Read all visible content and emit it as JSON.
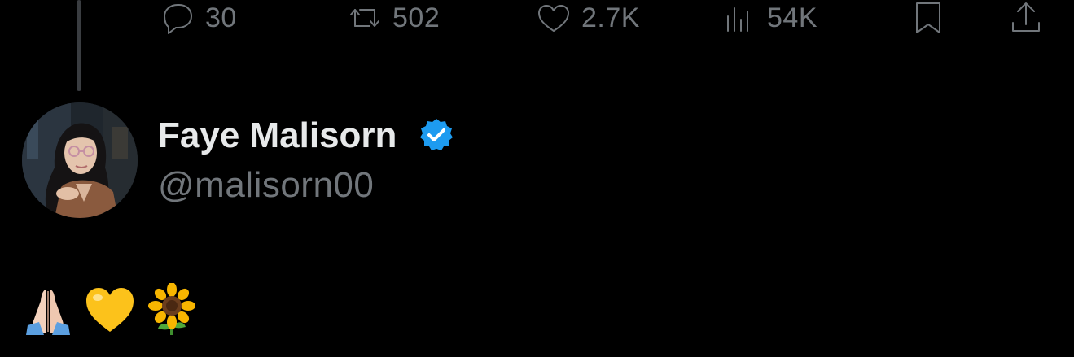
{
  "actions": {
    "reply": {
      "icon": "reply-icon",
      "count": "30"
    },
    "repost": {
      "icon": "repost-icon",
      "count": "502"
    },
    "like": {
      "icon": "heart-icon",
      "count": "2.7K"
    },
    "views": {
      "icon": "views-icon",
      "count": "54K"
    },
    "bookmark": {
      "icon": "bookmark-icon"
    },
    "share": {
      "icon": "share-icon"
    }
  },
  "author": {
    "display_name": "Faye Malisorn",
    "handle": "@malisorn00",
    "verified": true,
    "verified_color": "#1d9bf0"
  },
  "tweet": {
    "emojis": [
      "folded-hands",
      "yellow-heart",
      "sunflower"
    ]
  },
  "colors": {
    "background": "#000000",
    "primary_text": "#e7e9ea",
    "secondary_text": "#71767b",
    "divider": "#2f3336"
  }
}
